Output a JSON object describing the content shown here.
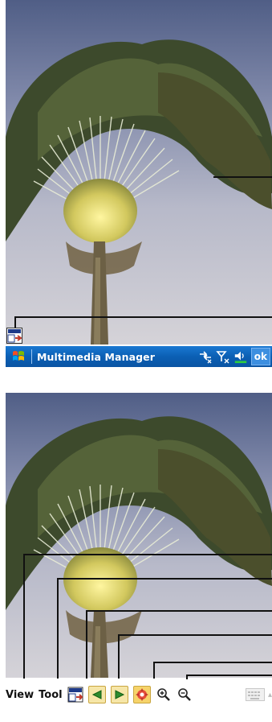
{
  "taskbar": {
    "title": "Multimedia Manager",
    "ok_label": "ok",
    "color": "#0b5fb4"
  },
  "menubar": {
    "view_label": "View",
    "tool_label": "Tool"
  },
  "icons": {
    "start": "windows-flag-icon",
    "connectivity": "connectivity-off-icon",
    "signal": "signal-off-icon",
    "volume": "volume-icon",
    "toggle": "full-screen-toggle-icon",
    "previous": "previous-image-icon",
    "next": "next-image-icon",
    "rotate": "rotate-icon",
    "zoom_in": "zoom-in-icon",
    "zoom_out": "zoom-out-icon",
    "keyboard": "keyboard-icon"
  }
}
